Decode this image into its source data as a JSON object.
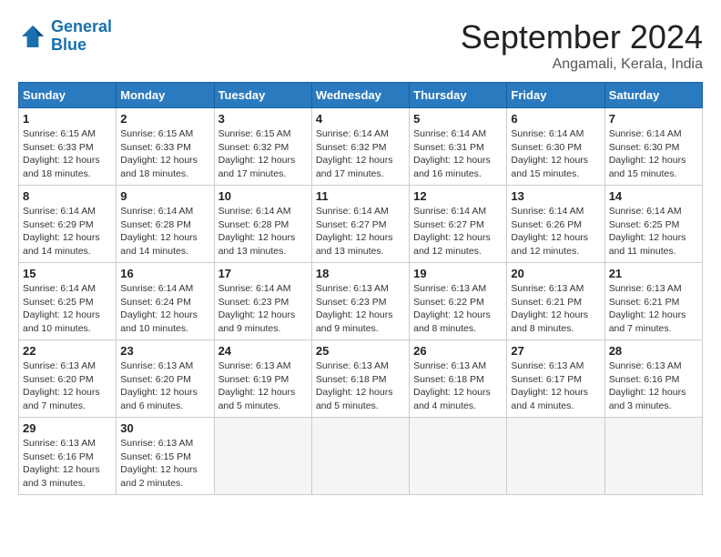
{
  "logo": {
    "line1": "General",
    "line2": "Blue"
  },
  "title": "September 2024",
  "location": "Angamali, Kerala, India",
  "headers": [
    "Sunday",
    "Monday",
    "Tuesday",
    "Wednesday",
    "Thursday",
    "Friday",
    "Saturday"
  ],
  "weeks": [
    [
      {
        "day": "1",
        "sunrise": "6:15 AM",
        "sunset": "6:33 PM",
        "daylight": "12 hours and 18 minutes."
      },
      {
        "day": "2",
        "sunrise": "6:15 AM",
        "sunset": "6:33 PM",
        "daylight": "12 hours and 18 minutes."
      },
      {
        "day": "3",
        "sunrise": "6:15 AM",
        "sunset": "6:32 PM",
        "daylight": "12 hours and 17 minutes."
      },
      {
        "day": "4",
        "sunrise": "6:14 AM",
        "sunset": "6:32 PM",
        "daylight": "12 hours and 17 minutes."
      },
      {
        "day": "5",
        "sunrise": "6:14 AM",
        "sunset": "6:31 PM",
        "daylight": "12 hours and 16 minutes."
      },
      {
        "day": "6",
        "sunrise": "6:14 AM",
        "sunset": "6:30 PM",
        "daylight": "12 hours and 15 minutes."
      },
      {
        "day": "7",
        "sunrise": "6:14 AM",
        "sunset": "6:30 PM",
        "daylight": "12 hours and 15 minutes."
      }
    ],
    [
      {
        "day": "8",
        "sunrise": "6:14 AM",
        "sunset": "6:29 PM",
        "daylight": "12 hours and 14 minutes."
      },
      {
        "day": "9",
        "sunrise": "6:14 AM",
        "sunset": "6:28 PM",
        "daylight": "12 hours and 14 minutes."
      },
      {
        "day": "10",
        "sunrise": "6:14 AM",
        "sunset": "6:28 PM",
        "daylight": "12 hours and 13 minutes."
      },
      {
        "day": "11",
        "sunrise": "6:14 AM",
        "sunset": "6:27 PM",
        "daylight": "12 hours and 13 minutes."
      },
      {
        "day": "12",
        "sunrise": "6:14 AM",
        "sunset": "6:27 PM",
        "daylight": "12 hours and 12 minutes."
      },
      {
        "day": "13",
        "sunrise": "6:14 AM",
        "sunset": "6:26 PM",
        "daylight": "12 hours and 12 minutes."
      },
      {
        "day": "14",
        "sunrise": "6:14 AM",
        "sunset": "6:25 PM",
        "daylight": "12 hours and 11 minutes."
      }
    ],
    [
      {
        "day": "15",
        "sunrise": "6:14 AM",
        "sunset": "6:25 PM",
        "daylight": "12 hours and 10 minutes."
      },
      {
        "day": "16",
        "sunrise": "6:14 AM",
        "sunset": "6:24 PM",
        "daylight": "12 hours and 10 minutes."
      },
      {
        "day": "17",
        "sunrise": "6:14 AM",
        "sunset": "6:23 PM",
        "daylight": "12 hours and 9 minutes."
      },
      {
        "day": "18",
        "sunrise": "6:13 AM",
        "sunset": "6:23 PM",
        "daylight": "12 hours and 9 minutes."
      },
      {
        "day": "19",
        "sunrise": "6:13 AM",
        "sunset": "6:22 PM",
        "daylight": "12 hours and 8 minutes."
      },
      {
        "day": "20",
        "sunrise": "6:13 AM",
        "sunset": "6:21 PM",
        "daylight": "12 hours and 8 minutes."
      },
      {
        "day": "21",
        "sunrise": "6:13 AM",
        "sunset": "6:21 PM",
        "daylight": "12 hours and 7 minutes."
      }
    ],
    [
      {
        "day": "22",
        "sunrise": "6:13 AM",
        "sunset": "6:20 PM",
        "daylight": "12 hours and 7 minutes."
      },
      {
        "day": "23",
        "sunrise": "6:13 AM",
        "sunset": "6:20 PM",
        "daylight": "12 hours and 6 minutes."
      },
      {
        "day": "24",
        "sunrise": "6:13 AM",
        "sunset": "6:19 PM",
        "daylight": "12 hours and 5 minutes."
      },
      {
        "day": "25",
        "sunrise": "6:13 AM",
        "sunset": "6:18 PM",
        "daylight": "12 hours and 5 minutes."
      },
      {
        "day": "26",
        "sunrise": "6:13 AM",
        "sunset": "6:18 PM",
        "daylight": "12 hours and 4 minutes."
      },
      {
        "day": "27",
        "sunrise": "6:13 AM",
        "sunset": "6:17 PM",
        "daylight": "12 hours and 4 minutes."
      },
      {
        "day": "28",
        "sunrise": "6:13 AM",
        "sunset": "6:16 PM",
        "daylight": "12 hours and 3 minutes."
      }
    ],
    [
      {
        "day": "29",
        "sunrise": "6:13 AM",
        "sunset": "6:16 PM",
        "daylight": "12 hours and 3 minutes."
      },
      {
        "day": "30",
        "sunrise": "6:13 AM",
        "sunset": "6:15 PM",
        "daylight": "12 hours and 2 minutes."
      },
      null,
      null,
      null,
      null,
      null
    ]
  ]
}
